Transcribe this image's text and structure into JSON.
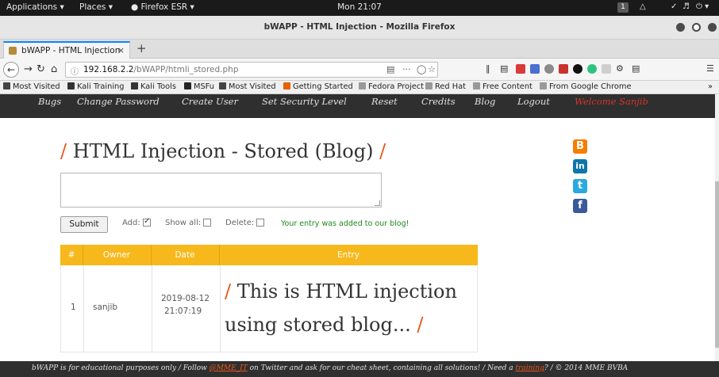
{
  "topbar": {
    "applications": "Applications ▾",
    "places": "Places ▾",
    "firefox_menu": "Firefox ESR ▾",
    "clock": "Mon 21:07",
    "workspace": "1"
  },
  "window": {
    "title": "bWAPP - HTML Injection - Mozilla Firefox"
  },
  "tab": {
    "label": "bWAPP - HTML Injection",
    "close": "×",
    "new_tab": "+"
  },
  "navbar": {
    "url_host": "192.168.2.2",
    "url_path": "/bWAPP/htmli_stored.php",
    "more": "···"
  },
  "bookmarks": [
    {
      "label": "Most Visited",
      "color": "#444"
    },
    {
      "label": "Kali Training",
      "color": "#333"
    },
    {
      "label": "Kali Tools",
      "color": "#333"
    },
    {
      "label": "MSFu",
      "color": "#222"
    },
    {
      "label": "Most Visited",
      "color": "#444"
    },
    {
      "label": "Getting Started",
      "color": "#e66000"
    },
    {
      "label": "Fedora Project",
      "color": "#999"
    },
    {
      "label": "Red Hat",
      "color": "#999"
    },
    {
      "label": "Free Content",
      "color": "#999"
    },
    {
      "label": "From Google Chrome",
      "color": "#999"
    }
  ],
  "bookmarks_overflow": "»",
  "menu": {
    "items": [
      "Bugs",
      "Change Password",
      "Create User",
      "Set Security Level",
      "Reset",
      "Credits",
      "Blog",
      "Logout"
    ],
    "welcome": "Welcome Sanjib"
  },
  "page": {
    "title_slash_left": "/",
    "title": "HTML Injection - Stored (Blog)",
    "title_slash_right": "/",
    "submit": "Submit",
    "add_label": "Add:",
    "show_all_label": "Show all:",
    "delete_label": "Delete:",
    "success": "Your entry was added to our blog!"
  },
  "table": {
    "headers": [
      "#",
      "Owner",
      "Date",
      "Entry"
    ],
    "row": {
      "num": "1",
      "owner": "sanjib",
      "date_line1": "2019-08-12",
      "date_line2": "21:07:19",
      "entry_slash_left": "/",
      "entry_text": "This is HTML injection using stored blog...",
      "entry_slash_right": "/"
    }
  },
  "social": [
    {
      "icon": "blogger-icon",
      "glyph": "B",
      "color": "#f57d00"
    },
    {
      "icon": "linkedin-icon",
      "glyph": "in",
      "color": "#0e76a8"
    },
    {
      "icon": "twitter-icon",
      "glyph": "t",
      "color": "#2aa9e0"
    },
    {
      "icon": "facebook-icon",
      "glyph": "f",
      "color": "#3b5998"
    }
  ],
  "footer": {
    "text_a": "bWAPP is for educational purposes only / Follow ",
    "link_a": "@MME_IT",
    "text_b": " on Twitter and ask for our cheat sheet, containing all solutions! / Need a ",
    "link_b": "training",
    "text_c": "? / © 2014 MME BVBA"
  }
}
